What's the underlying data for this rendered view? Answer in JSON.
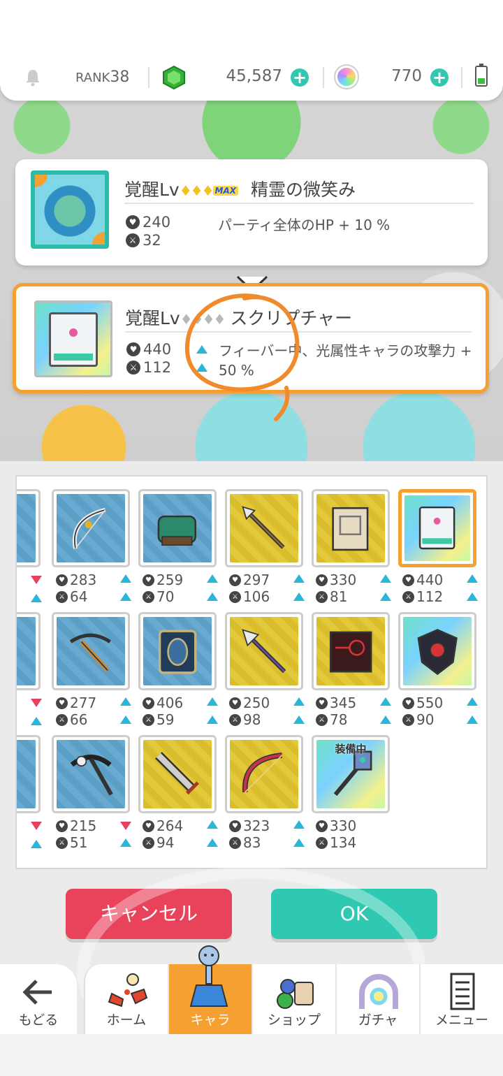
{
  "header": {
    "rank_label": "RANK",
    "rank_value": "38",
    "coins": "45,587",
    "orbs": "770",
    "plus": "+"
  },
  "current_ability": {
    "title_prefix": "覚醒Lv",
    "stars": "♦♦♦",
    "max_badge": "MAX",
    "name": "精霊の微笑み",
    "hp": "240",
    "atk": "32",
    "effect": "パーティ全体のHP + 10 %"
  },
  "new_ability": {
    "title_prefix": "覚醒Lv",
    "stars": "♦♦♦♦",
    "name": "スクリプチャー",
    "hp": "440",
    "atk": "112",
    "effect_line1": "フィーバー中、光属性キャラの攻撃力 +",
    "effect_line2": "50 %"
  },
  "items": [
    {
      "hp": "283",
      "atk": "64",
      "hp_dir": "up",
      "atk_dir": "up",
      "bg": "blue",
      "weapon": "bow-icon"
    },
    {
      "hp": "259",
      "atk": "70",
      "hp_dir": "up",
      "atk_dir": "up",
      "bg": "blue",
      "weapon": "gauntlet-icon"
    },
    {
      "hp": "297",
      "atk": "106",
      "hp_dir": "up",
      "atk_dir": "up",
      "bg": "gold",
      "weapon": "spear-icon"
    },
    {
      "hp": "330",
      "atk": "81",
      "hp_dir": "up",
      "atk_dir": "up",
      "bg": "gold",
      "weapon": "tome-icon"
    },
    {
      "hp": "440",
      "atk": "112",
      "hp_dir": "up",
      "atk_dir": "up",
      "bg": "rainbow",
      "weapon": "scripture-book-icon",
      "selected": true
    },
    {
      "hp": "277",
      "atk": "66",
      "hp_dir": "up",
      "atk_dir": "up",
      "bg": "blue",
      "weapon": "crossbow-icon"
    },
    {
      "hp": "406",
      "atk": "59",
      "hp_dir": "up",
      "atk_dir": "up",
      "bg": "blue",
      "weapon": "shield-tome-icon"
    },
    {
      "hp": "250",
      "atk": "98",
      "hp_dir": "up",
      "atk_dir": "up",
      "bg": "gold",
      "weapon": "halberd-icon"
    },
    {
      "hp": "345",
      "atk": "78",
      "hp_dir": "up",
      "atk_dir": "up",
      "bg": "gold",
      "weapon": "red-grimoire-icon"
    },
    {
      "hp": "550",
      "atk": "90",
      "hp_dir": "up",
      "atk_dir": "up",
      "bg": "rainbow",
      "weapon": "dark-shield-icon"
    },
    {
      "hp": "215",
      "atk": "51",
      "hp_dir": "down",
      "atk_dir": "up",
      "bg": "blue",
      "weapon": "pickaxe-icon"
    },
    {
      "hp": "264",
      "atk": "94",
      "hp_dir": "up",
      "atk_dir": "up",
      "bg": "gold",
      "weapon": "greatsword-icon"
    },
    {
      "hp": "323",
      "atk": "83",
      "hp_dir": "up",
      "atk_dir": "up",
      "bg": "gold",
      "weapon": "red-bow-icon"
    },
    {
      "hp": "330",
      "atk": "134",
      "hp_dir": "none",
      "atk_dir": "none",
      "bg": "rainbow",
      "weapon": "axe-icon",
      "equipped_label": "装備中"
    }
  ],
  "partial_column": [
    {
      "hp_dir": "down"
    },
    {
      "hp_dir": "down"
    },
    {
      "hp_dir": "down"
    }
  ],
  "buttons": {
    "cancel": "キャンセル",
    "ok": "OK"
  },
  "nav": {
    "back": "もどる",
    "home": "ホーム",
    "chara": "キャラ",
    "shop": "ショップ",
    "gacha": "ガチャ",
    "menu": "メニュー"
  },
  "colors": {
    "accent_teal": "#2fc9b1",
    "accent_orange": "#f7a032",
    "cancel_red": "#e9425b",
    "up_arrow": "#29b6d8",
    "down_arrow": "#e6405a"
  }
}
